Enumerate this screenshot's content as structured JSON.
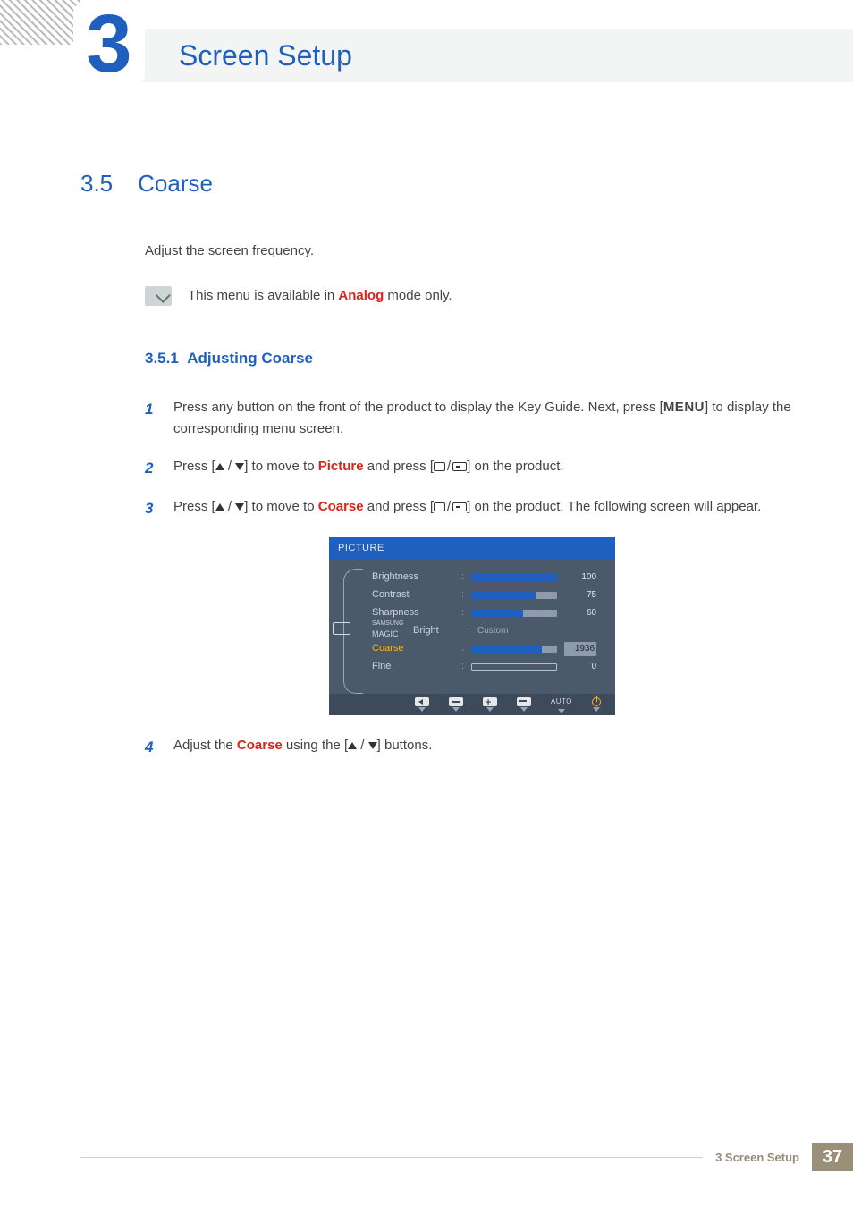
{
  "chapter": {
    "number": "3",
    "title": "Screen Setup"
  },
  "section": {
    "number": "3.5",
    "title": "Coarse"
  },
  "intro": "Adjust the screen frequency.",
  "note": {
    "before": "This menu is available in ",
    "mode": "Analog",
    "after": " mode only."
  },
  "subsection": {
    "number": "3.5.1",
    "title": "Adjusting Coarse"
  },
  "steps": {
    "s1_num": "1",
    "s1a": "Press any button on the front of the product to display the Key Guide. Next, press [",
    "s1_menu": "MENU",
    "s1b": "] to display the corresponding menu screen.",
    "s2_num": "2",
    "s2a": "Press [",
    "s2b": "] to move to ",
    "s2_hl": "Picture",
    "s2c": " and press [",
    "s2d": "] on the product.",
    "s3_num": "3",
    "s3a": "Press [",
    "s3b": "] to move to ",
    "s3_hl": "Coarse",
    "s3c": " and press [",
    "s3d": "] on the product. The following screen will appear.",
    "s4_num": "4",
    "s4a": "Adjust the ",
    "s4_hl": "Coarse",
    "s4b": " using the [",
    "s4c": "] buttons."
  },
  "osd": {
    "title": "PICTURE",
    "rows": [
      {
        "label": "Brightness",
        "value": 100,
        "fill": 100,
        "type": "bar"
      },
      {
        "label": "Contrast",
        "value": 75,
        "fill": 75,
        "type": "bar"
      },
      {
        "label": "Sharpness",
        "value": 60,
        "fill": 60,
        "type": "bar"
      },
      {
        "label_top": "SAMSUNG",
        "label_mid": "MAGIC",
        "label_right": "Bright",
        "text": "Custom",
        "type": "text"
      },
      {
        "label": "Coarse",
        "value": 1936,
        "fill": 82,
        "type": "bar-sel"
      },
      {
        "label": "Fine",
        "value": 0,
        "fill": 0,
        "type": "bar-outline"
      }
    ],
    "footer_auto": "AUTO"
  },
  "footer": {
    "label": "3 Screen Setup",
    "page": "37"
  }
}
